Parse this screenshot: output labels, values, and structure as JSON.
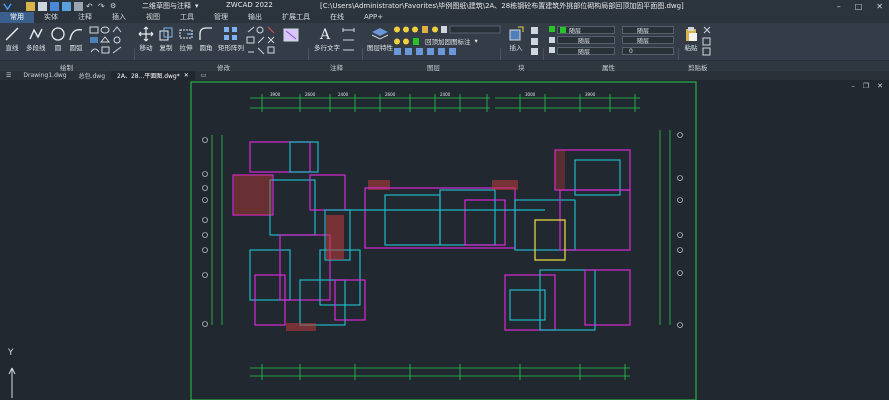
{
  "app_name": "ZWCAD 2022",
  "document_title": "[C:\\Users\\Administrator\\Favorites\\毕例图纸\\建筑\\2A、28栋钢砼布置建筑外挑部位砌构局部回顶加固平面图.dwg]",
  "workspace": "二维草图与注释",
  "tabs": [
    "常用",
    "实体",
    "注释",
    "插入",
    "视图",
    "工具",
    "管理",
    "输出",
    "扩展工具",
    "在线",
    "APP+"
  ],
  "ribbon": {
    "draw": {
      "line": "直线",
      "polyline": "多段线",
      "circle": "圆",
      "arc": "圆弧"
    },
    "modify": {
      "move": "移动",
      "copy": "复制",
      "stretch": "拉伸",
      "fillet": "圆角",
      "array": "矩形阵列"
    },
    "annotation": {
      "mtext": "多行文字"
    },
    "layers": {
      "layer_props": "图层特性",
      "layer_state": "回顶加固图标注"
    },
    "block": {
      "insert": "插入"
    },
    "properties": {
      "color": "随层",
      "linetype": "随层",
      "lineweight": "随层",
      "value": "0"
    },
    "clipboard": {
      "paste": "粘贴"
    },
    "panel_labels": {
      "draw": "绘制",
      "modify": "修改",
      "annotation": "注释",
      "layers": "图层",
      "block": "块",
      "properties": "属性",
      "clipboard": "剪贴板"
    }
  },
  "doc_tabs": [
    "Drawing1.dwg",
    "总包.dwg",
    "2A、28...平面图.dwg*"
  ],
  "ucs": {
    "y_label": "Y"
  },
  "colors": {
    "accent_tab": "#3a5f8c",
    "wall_magenta": "#d62ad6",
    "wall_cyan": "#1fb8c6",
    "axis_green": "#27c84a",
    "hatch_red": "#c03a3a"
  }
}
